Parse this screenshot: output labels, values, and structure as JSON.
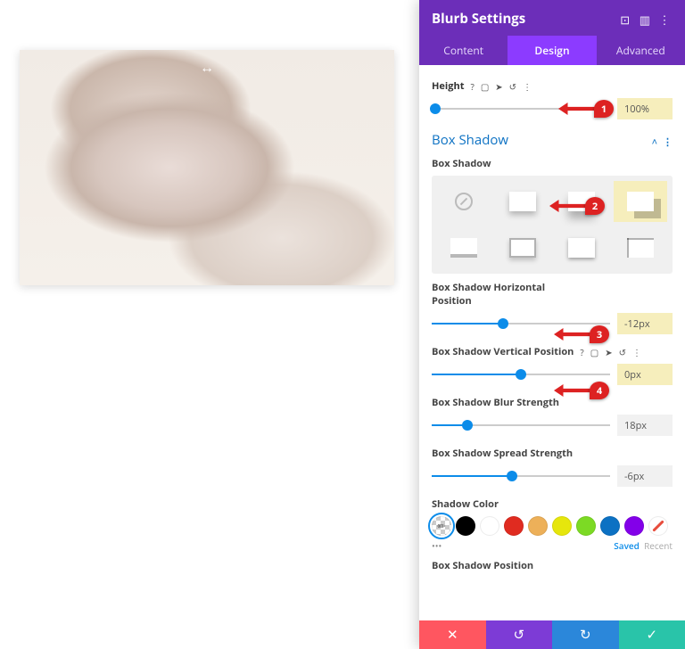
{
  "header": {
    "title": "Blurb Settings"
  },
  "tabs": {
    "content": "Content",
    "design": "Design",
    "advanced": "Advanced",
    "active": "design"
  },
  "height": {
    "label": "Height",
    "value": "100%",
    "percent": 2
  },
  "section": {
    "title": "Box Shadow"
  },
  "presetsLabel": "Box Shadow",
  "horiz": {
    "label": "Box Shadow Horizontal Position",
    "value": "-12px",
    "percent": 40
  },
  "vert": {
    "label": "Box Shadow Vertical Position",
    "value": "0px",
    "percent": 50
  },
  "blur": {
    "label": "Box Shadow Blur Strength",
    "value": "18px",
    "percent": 20
  },
  "spread": {
    "label": "Box Shadow Spread Strength",
    "value": "-6px",
    "percent": 45
  },
  "color": {
    "label": "Shadow Color",
    "saved": "Saved",
    "recent": "Recent",
    "swatches": [
      "transparent",
      "#000000",
      "#ffffff",
      "#e02b20",
      "#edb059",
      "#e6e60c",
      "#7cda24",
      "#0c71c3",
      "#8300e9",
      "strike"
    ]
  },
  "posLabel": "Box Shadow Position",
  "callouts": {
    "c1": "1",
    "c2": "2",
    "c3": "3",
    "c4": "4"
  }
}
